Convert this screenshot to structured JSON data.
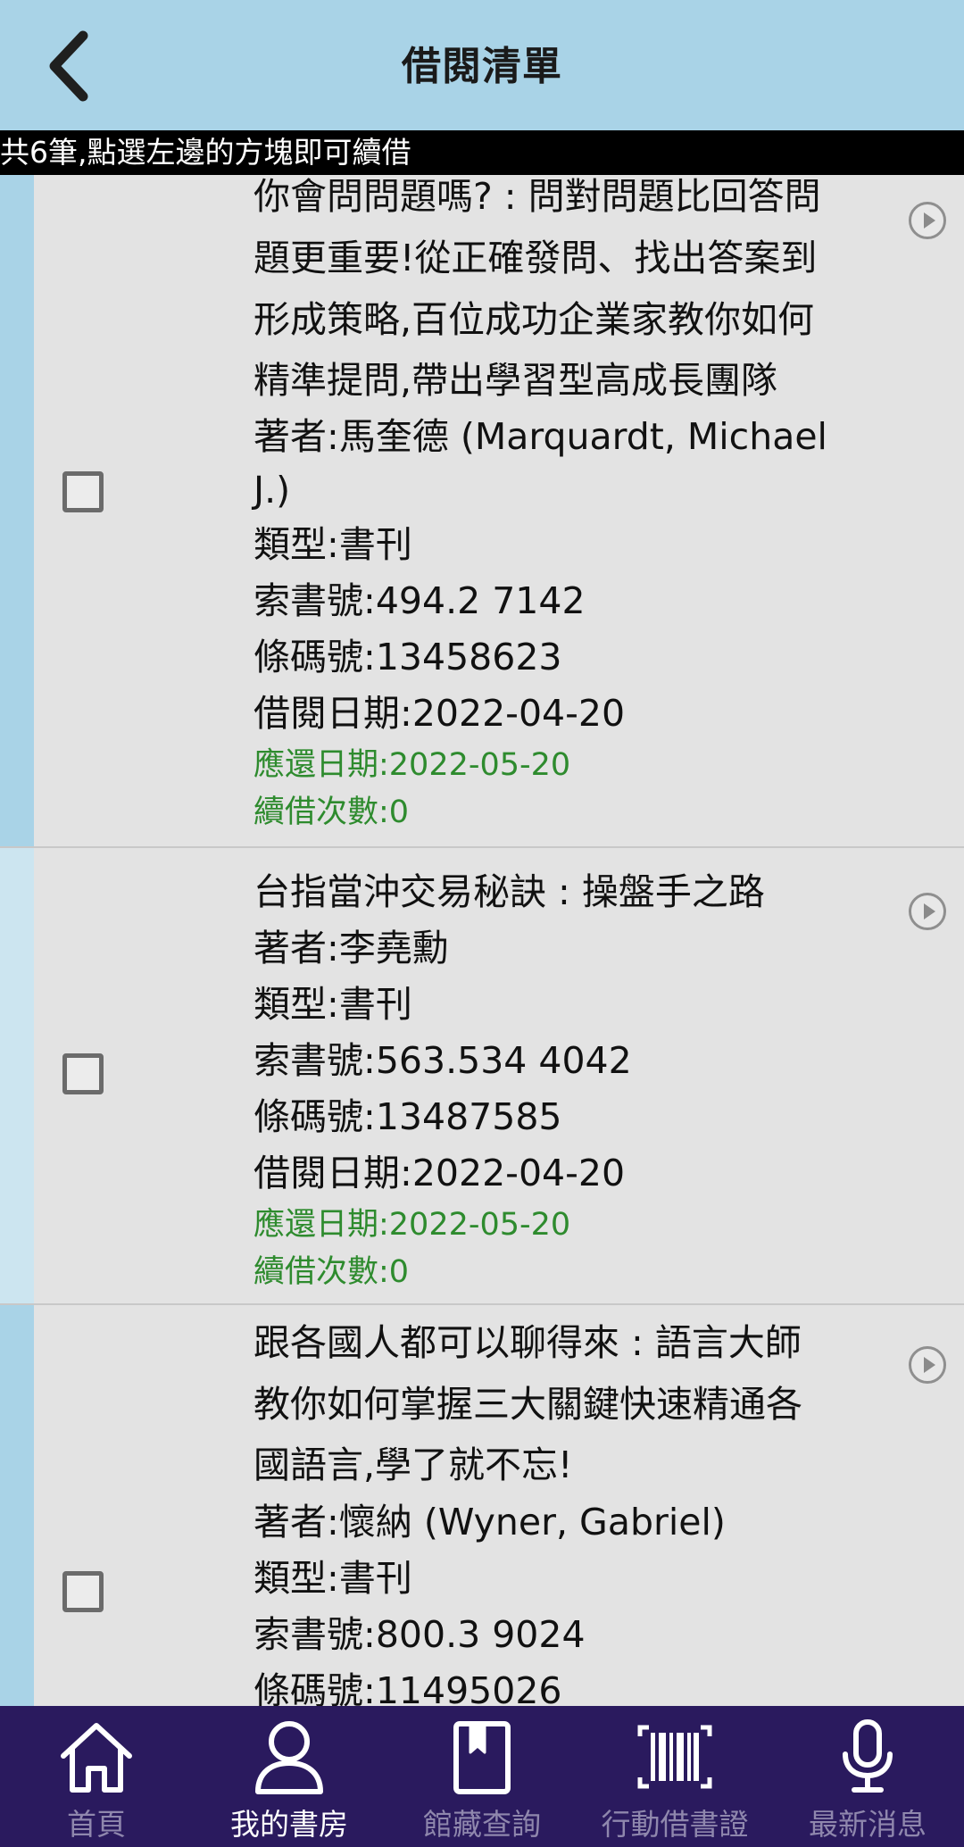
{
  "header": {
    "title": "借閱清單"
  },
  "info_bar": {
    "text": "共6筆,點選左邊的方塊即可續借"
  },
  "items": [
    {
      "title_lines": [
        "你會問問題嗎? : 問對問題比回答問",
        "題更重要!從正確發問、找出答案到",
        "形成策略,百位成功企業家教你如何",
        "精準提問,帶出學習型高成長團隊"
      ],
      "author_lines": [
        "著者:馬奎德 (Marquardt, Michael",
        "J.)"
      ],
      "type": "類型:書刊",
      "call_number": "索書號:494.2 7142",
      "barcode": "條碼號:13458623",
      "borrow_date": "借閱日期:2022-04-20",
      "due_date": "應還日期:2022-05-20",
      "renew_count": "續借次數:0"
    },
    {
      "title_lines": [
        "台指當沖交易秘訣 : 操盤手之路"
      ],
      "author_lines": [
        "著者:李堯勳"
      ],
      "type": "類型:書刊",
      "call_number": "索書號:563.534 4042",
      "barcode": "條碼號:13487585",
      "borrow_date": "借閱日期:2022-04-20",
      "due_date": "應還日期:2022-05-20",
      "renew_count": "續借次數:0"
    },
    {
      "title_lines": [
        "跟各國人都可以聊得來 : 語言大師",
        "教你如何掌握三大關鍵快速精通各",
        "國語言,學了就不忘!"
      ],
      "author_lines": [
        "著者:懷納 (Wyner, Gabriel)"
      ],
      "type": "類型:書刊",
      "call_number": "索書號:800.3 9024",
      "barcode": "條碼號:11495026"
    }
  ],
  "tabs": [
    {
      "label": "首頁",
      "icon": "home-icon",
      "active": false
    },
    {
      "label": "我的書房",
      "icon": "user-icon",
      "active": true
    },
    {
      "label": "館藏查詢",
      "icon": "book-icon",
      "active": false
    },
    {
      "label": "行動借書證",
      "icon": "barcode-icon",
      "active": false
    },
    {
      "label": "最新消息",
      "icon": "microphone-icon",
      "active": false
    }
  ],
  "colors": {
    "header_bg": "#a9d3e7",
    "tabbar_bg": "#2a1a5e",
    "due_text": "#2e8b2e",
    "stripe_odd": "#a9d3e7",
    "stripe_even": "#cce5f0"
  }
}
